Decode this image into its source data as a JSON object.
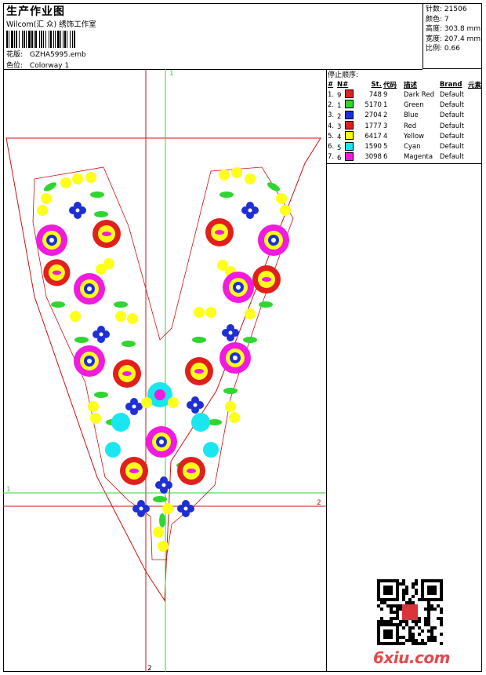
{
  "header": {
    "title": "生产作业图",
    "subtitle": "Wilcom(汇 众) 绣饰工作室",
    "pattern_label": "花版:",
    "pattern_value": "GZHA5995.emb",
    "colorway_label": "色位:",
    "colorway_value": "Colorway 1"
  },
  "stats": {
    "stitches_label": "针数:",
    "stitches_value": "21506",
    "colors_label": "颜色:",
    "colors_value": "7",
    "height_label": "高度:",
    "height_value": "303.8 mm",
    "width_label": "宽度:",
    "width_value": "207.4 mm",
    "scale_label": "比例:",
    "scale_value": "0.66"
  },
  "stop_sequence": {
    "title": "停止顺序:",
    "columns": [
      "#",
      "N#",
      "St.",
      "代码",
      "描述",
      "Brand",
      "元素"
    ],
    "rows": [
      {
        "idx": "1.",
        "n": "9",
        "color": "#e0201c",
        "st": "748",
        "code": "9",
        "desc": "Dark Red",
        "brand": "Default"
      },
      {
        "idx": "2.",
        "n": "1",
        "color": "#2fd62f",
        "st": "5170",
        "code": "1",
        "desc": "Green",
        "brand": "Default"
      },
      {
        "idx": "3.",
        "n": "2",
        "color": "#1f2fd6",
        "st": "2704",
        "code": "2",
        "desc": "Blue",
        "brand": "Default"
      },
      {
        "idx": "4.",
        "n": "3",
        "color": "#e0201c",
        "st": "1777",
        "code": "3",
        "desc": "Red",
        "brand": "Default"
      },
      {
        "idx": "5.",
        "n": "4",
        "color": "#ffff1a",
        "st": "6417",
        "code": "4",
        "desc": "Yellow",
        "brand": "Default"
      },
      {
        "idx": "6.",
        "n": "5",
        "color": "#1ae6f0",
        "st": "1590",
        "code": "5",
        "desc": "Cyan",
        "brand": "Default"
      },
      {
        "idx": "7.",
        "n": "6",
        "color": "#f01ae0",
        "st": "3098",
        "code": "6",
        "desc": "Magenta",
        "brand": "Default"
      }
    ]
  },
  "guides": {
    "v_top": "1",
    "v_bottom": "2",
    "h_left": "1",
    "h_right": "2"
  },
  "watermark": "6xiu.com"
}
